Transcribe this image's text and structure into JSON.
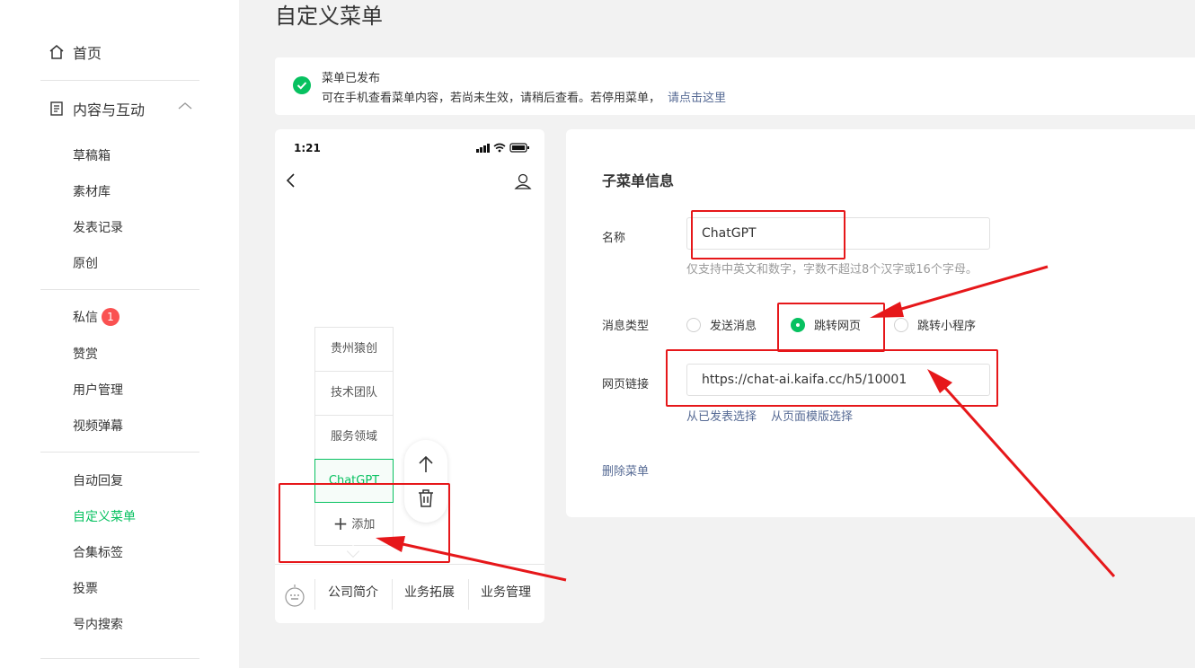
{
  "sidebar": {
    "home": "首页",
    "group": "内容与互动",
    "items": [
      {
        "label": "草稿箱"
      },
      {
        "label": "素材库"
      },
      {
        "label": "发表记录"
      },
      {
        "label": "原创"
      },
      {
        "label": "私信",
        "badge": "1"
      },
      {
        "label": "赞赏"
      },
      {
        "label": "用户管理"
      },
      {
        "label": "视频弹幕"
      },
      {
        "label": "自动回复"
      },
      {
        "label": "自定义菜单",
        "active": true
      },
      {
        "label": "合集标签"
      },
      {
        "label": "投票"
      },
      {
        "label": "号内搜索"
      }
    ]
  },
  "page": {
    "title": "自定义菜单"
  },
  "notice": {
    "title": "菜单已发布",
    "message": "可在手机查看菜单内容，若尚未生效，请稍后查看。若停用菜单，",
    "link": "请点击这里"
  },
  "phone": {
    "time": "1:21",
    "submenu": [
      "贵州猿创",
      "技术团队",
      "服务领域",
      "ChatGPT"
    ],
    "submenu_selected": "ChatGPT",
    "add_label": "添加",
    "menubar": [
      "公司简介",
      "业务拓展",
      "业务管理"
    ]
  },
  "form": {
    "title": "子菜单信息",
    "name_label": "名称",
    "name_value": "ChatGPT",
    "name_hint": "仅支持中英文和数字，字数不超过8个汉字或16个字母。",
    "type_label": "消息类型",
    "type_options": [
      "发送消息",
      "跳转网页",
      "跳转小程序"
    ],
    "type_selected": "跳转网页",
    "url_label": "网页链接",
    "url_value": "https://chat-ai.kaifa.cc/h5/10001",
    "link_published": "从已发表选择",
    "link_template": "从页面模版选择",
    "delete_label": "删除菜单"
  },
  "colors": {
    "accent": "#07c160",
    "link": "#576b95",
    "annotation": "#e6171a"
  }
}
